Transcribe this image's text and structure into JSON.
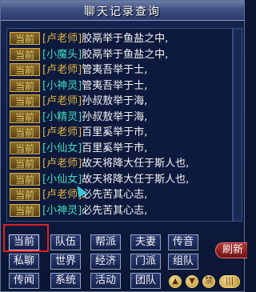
{
  "window": {
    "title": "聊天记录查询"
  },
  "messages": [
    {
      "channel": "当前",
      "sender": "[卢老师]",
      "sender_color": "#e2b63e",
      "text": "胶鬲举于鱼盐之中,"
    },
    {
      "channel": "当前",
      "sender": "[小魔头]",
      "sender_color": "#3fdcbc",
      "text": "胶鬲举于鱼盐之中,"
    },
    {
      "channel": "当前",
      "sender": "[卢老师]",
      "sender_color": "#e2b63e",
      "text": "管夷吾举于士,"
    },
    {
      "channel": "当前",
      "sender": "[小神灵]",
      "sender_color": "#3fdcbc",
      "text": "管夷吾举于士,"
    },
    {
      "channel": "当前",
      "sender": "[卢老师]",
      "sender_color": "#e2b63e",
      "text": "孙叔敖举于海,"
    },
    {
      "channel": "当前",
      "sender": "[小精灵]",
      "sender_color": "#3fdcbc",
      "text": "孙叔敖举于海,"
    },
    {
      "channel": "当前",
      "sender": "[卢老师]",
      "sender_color": "#e2b63e",
      "text": "百里奚举于市,"
    },
    {
      "channel": "当前",
      "sender": "[小仙女]",
      "sender_color": "#3fdcbc",
      "text": "百里奚举于市,"
    },
    {
      "channel": "当前",
      "sender": "[卢老师]",
      "sender_color": "#e2b63e",
      "text": "故天将降大任于斯人也,"
    },
    {
      "channel": "当前",
      "sender": "[小仙女]",
      "sender_color": "#3fdcbc",
      "text": "故天将降大任于斯人也,"
    },
    {
      "channel": "当前",
      "sender": "[卢老师]",
      "sender_color": "#e2b63e",
      "text": "必先苦其心志,"
    },
    {
      "channel": "当前",
      "sender": "[小神灵]",
      "sender_color": "#3fdcbc",
      "text": "必先苦其心志,"
    }
  ],
  "channels": {
    "current": "当前",
    "team": "队伍",
    "guild": "帮派",
    "spouse": "夫妻",
    "broadcast": "传音",
    "whisper": "私聊",
    "world": "世界",
    "economy": "经济",
    "faction": "门派",
    "group": "组队",
    "rumor": "传闻",
    "system": "系统",
    "activity": "活动",
    "corps": "团队"
  },
  "refresh_label": "刷新",
  "bottom_icons": {
    "forbid_label": "禁"
  },
  "colors": {
    "accent_gold": "#e2b63e",
    "accent_teal": "#3fdcbc",
    "highlight_red": "#e02020"
  }
}
